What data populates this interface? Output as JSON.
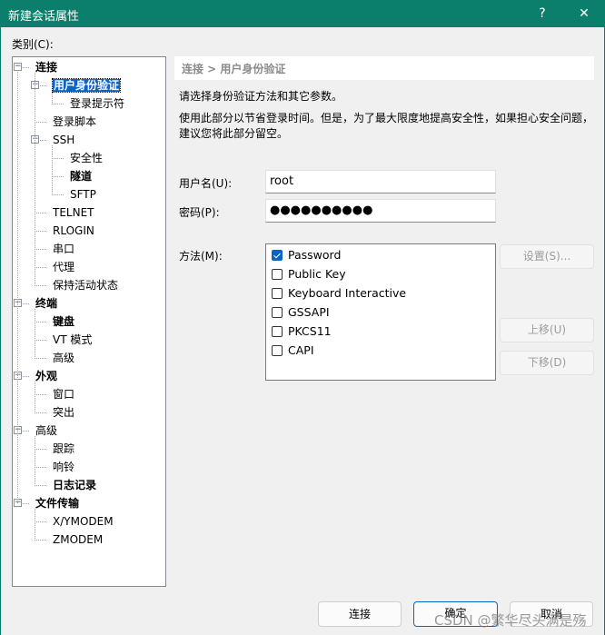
{
  "window": {
    "title": "新建会话属性",
    "help": "?",
    "close": "✕"
  },
  "category_label": "类别(C):",
  "tree": [
    {
      "label": "连接",
      "level": 0,
      "bold": true,
      "expanded": true
    },
    {
      "label": "用户身份验证",
      "level": 1,
      "bold": true,
      "expanded": true,
      "selected": true
    },
    {
      "label": "登录提示符",
      "level": 2
    },
    {
      "label": "登录脚本",
      "level": 1
    },
    {
      "label": "SSH",
      "level": 1,
      "expanded": true
    },
    {
      "label": "安全性",
      "level": 2
    },
    {
      "label": "隧道",
      "level": 2,
      "bold": true
    },
    {
      "label": "SFTP",
      "level": 2
    },
    {
      "label": "TELNET",
      "level": 1
    },
    {
      "label": "RLOGIN",
      "level": 1
    },
    {
      "label": "串口",
      "level": 1
    },
    {
      "label": "代理",
      "level": 1
    },
    {
      "label": "保持活动状态",
      "level": 1
    },
    {
      "label": "终端",
      "level": 0,
      "bold": true,
      "expanded": true
    },
    {
      "label": "键盘",
      "level": 1,
      "bold": true
    },
    {
      "label": "VT 模式",
      "level": 1
    },
    {
      "label": "高级",
      "level": 1
    },
    {
      "label": "外观",
      "level": 0,
      "bold": true,
      "expanded": true
    },
    {
      "label": "窗口",
      "level": 1
    },
    {
      "label": "突出",
      "level": 1
    },
    {
      "label": "高级",
      "level": 0,
      "expanded": true
    },
    {
      "label": "跟踪",
      "level": 1
    },
    {
      "label": "响铃",
      "level": 1
    },
    {
      "label": "日志记录",
      "level": 1,
      "bold": true
    },
    {
      "label": "文件传输",
      "level": 0,
      "bold": true,
      "expanded": true
    },
    {
      "label": "X/YMODEM",
      "level": 1
    },
    {
      "label": "ZMODEM",
      "level": 1
    }
  ],
  "breadcrumb": "连接 > 用户身份验证",
  "intro": "请选择身份验证方法和其它参数。",
  "note_line1": "使用此部分以节省登录时间。但是，为了最大限度地提高安全性，如果担心安全问题，",
  "note_line2": "建议您将此部分留空。",
  "username": {
    "label": "用户名(U):",
    "value": "root"
  },
  "password": {
    "label": "密码(P):",
    "value": "●●●●●●●●●●"
  },
  "method": {
    "label": "方法(M):",
    "items": [
      {
        "label": "Password",
        "checked": true
      },
      {
        "label": "Public Key",
        "checked": false
      },
      {
        "label": "Keyboard Interactive",
        "checked": false
      },
      {
        "label": "GSSAPI",
        "checked": false
      },
      {
        "label": "PKCS11",
        "checked": false
      },
      {
        "label": "CAPI",
        "checked": false
      }
    ]
  },
  "buttons": {
    "settings": "设置(S)...",
    "move_up": "上移(U)",
    "move_down": "下移(D)",
    "connect": "连接",
    "ok": "确定",
    "cancel": "取消"
  },
  "watermark": "CSDN @繁华尽头满是殇",
  "colors": {
    "titlebar": "#0b7f6c",
    "accent": "#0a64c8"
  }
}
